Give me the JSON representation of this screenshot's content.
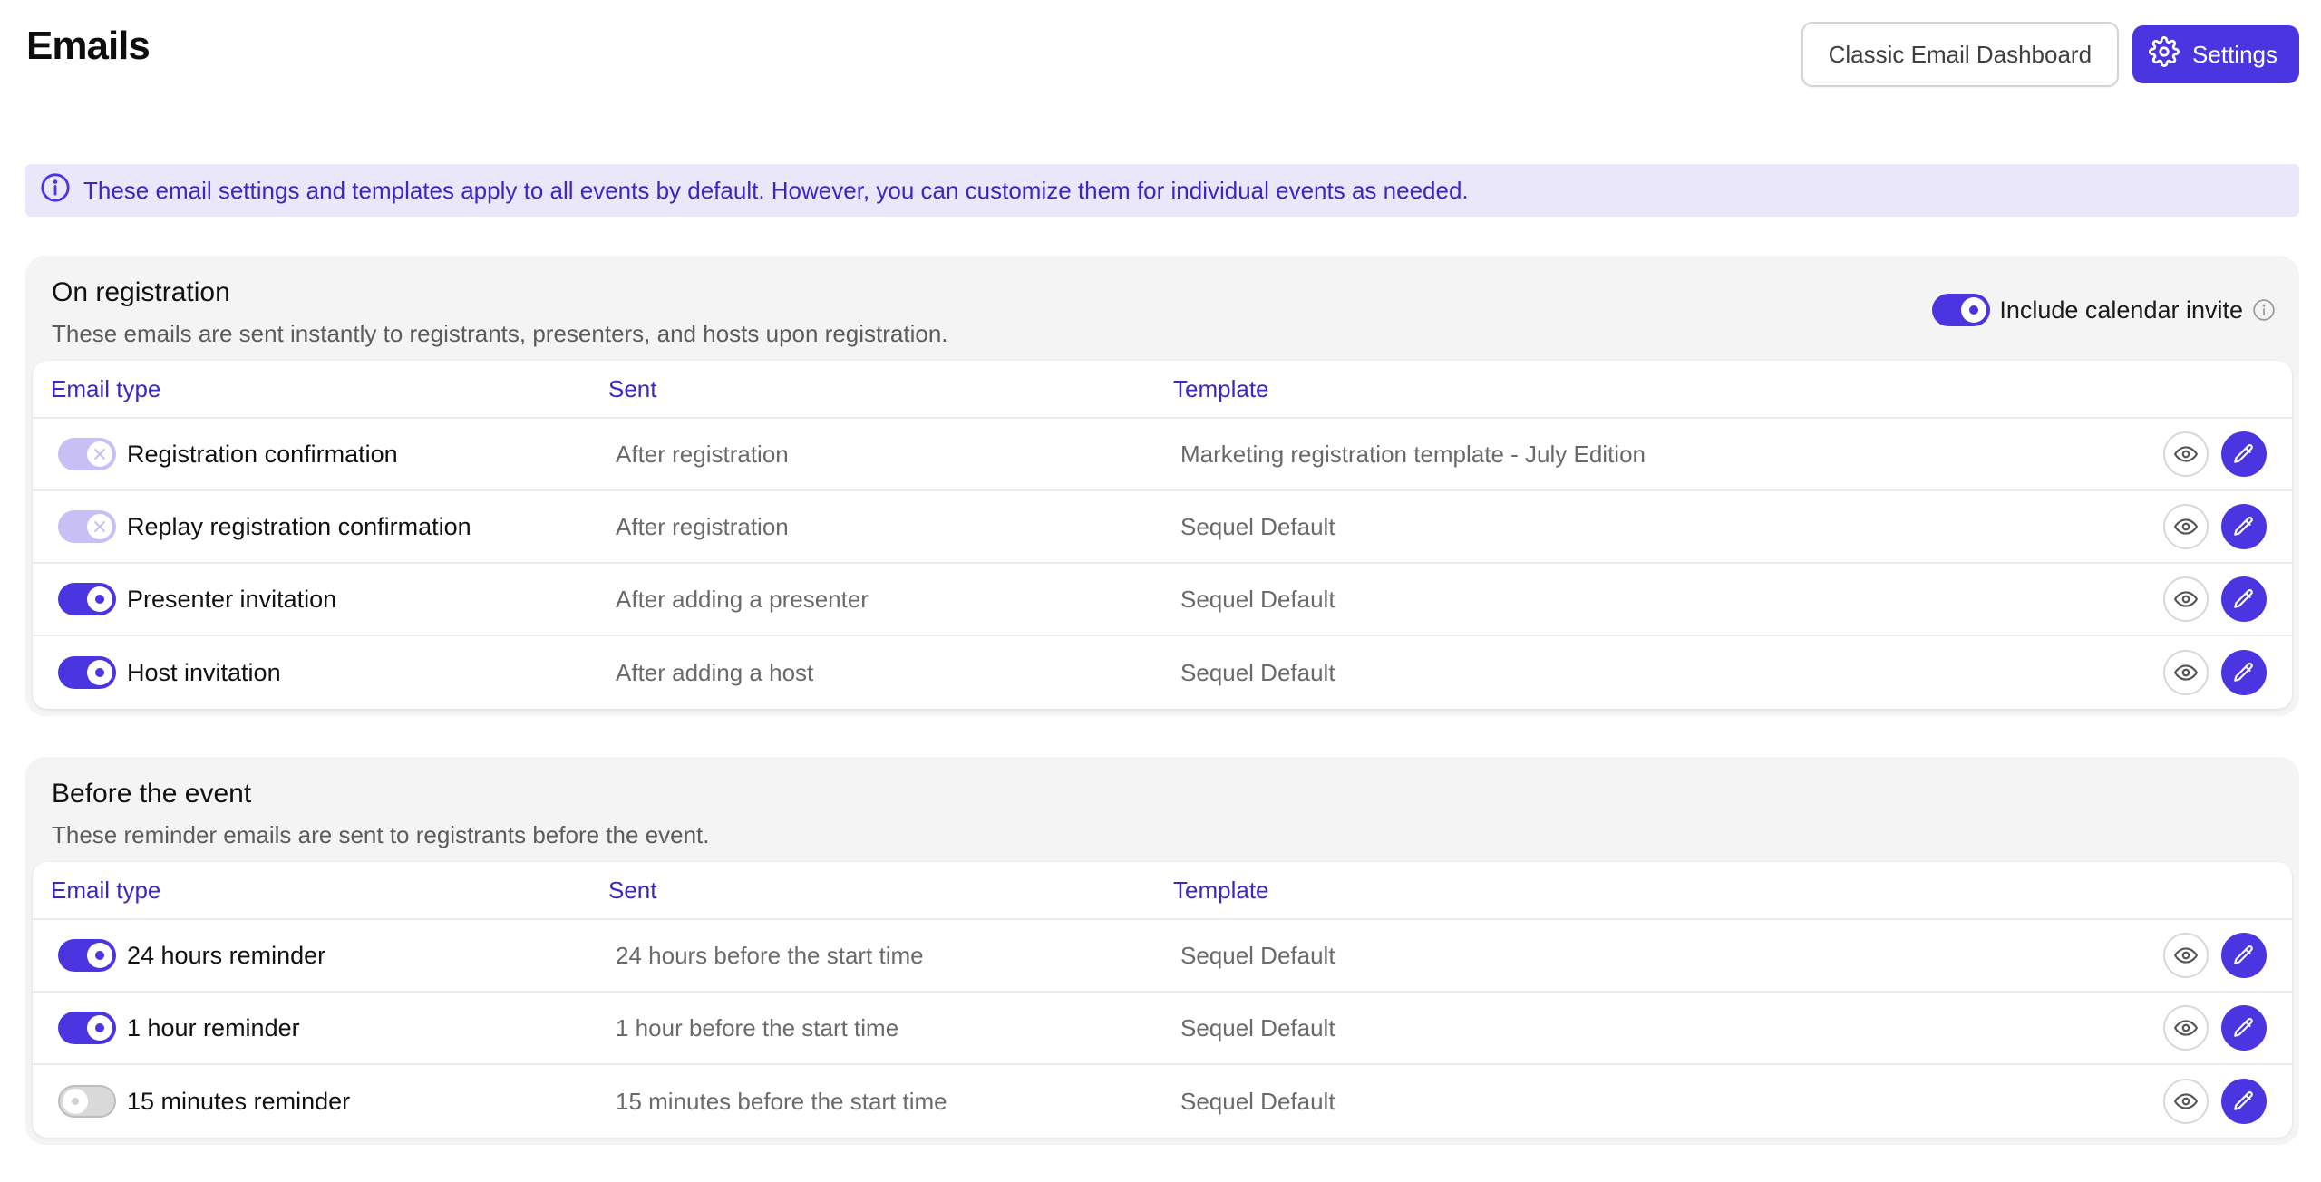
{
  "header": {
    "title": "Emails",
    "classic_button": "Classic Email Dashboard",
    "settings_button": "Settings"
  },
  "banner": {
    "text": "These email settings and templates apply to all events by default. However, you can customize them for individual events as needed."
  },
  "columns": {
    "type": "Email type",
    "sent": "Sent",
    "template": "Template"
  },
  "sections": [
    {
      "title": "On registration",
      "subtitle": "These emails are sent instantly to registrants, presenters, and hosts upon registration.",
      "calendar_invite_label": "Include calendar invite",
      "calendar_invite_enabled": true,
      "rows": [
        {
          "type": "Registration confirmation",
          "sent": "After registration",
          "template": "Marketing registration template - July Edition",
          "toggle": "locked"
        },
        {
          "type": "Replay registration confirmation",
          "sent": "After registration",
          "template": "Sequel Default",
          "toggle": "locked"
        },
        {
          "type": "Presenter invitation",
          "sent": "After adding a presenter",
          "template": "Sequel Default",
          "toggle": "on"
        },
        {
          "type": "Host invitation",
          "sent": "After adding a host",
          "template": "Sequel Default",
          "toggle": "on"
        }
      ]
    },
    {
      "title": "Before the event",
      "subtitle": "These reminder emails are sent to registrants before the event.",
      "rows": [
        {
          "type": "24 hours reminder",
          "sent": "24 hours before the start time",
          "template": "Sequel Default",
          "toggle": "on"
        },
        {
          "type": "1 hour reminder",
          "sent": "1 hour before the start time",
          "template": "Sequel Default",
          "toggle": "on"
        },
        {
          "type": "15 minutes reminder",
          "sent": "15 minutes before the start time",
          "template": "Sequel Default",
          "toggle": "off"
        }
      ]
    }
  ],
  "icons": {
    "settings": "gear-icon",
    "banner": "info-circle-icon",
    "calendar_info": "info-circle-icon",
    "preview": "eye-icon",
    "edit": "pencil-icon",
    "toggle_locked": "x-icon"
  },
  "colors": {
    "accent": "#4a35e0",
    "accent_text": "#3b28c4",
    "banner_bg": "#ebe7fa",
    "locked_toggle": "#c8c0f4",
    "section_bg": "#f4f4f4"
  }
}
